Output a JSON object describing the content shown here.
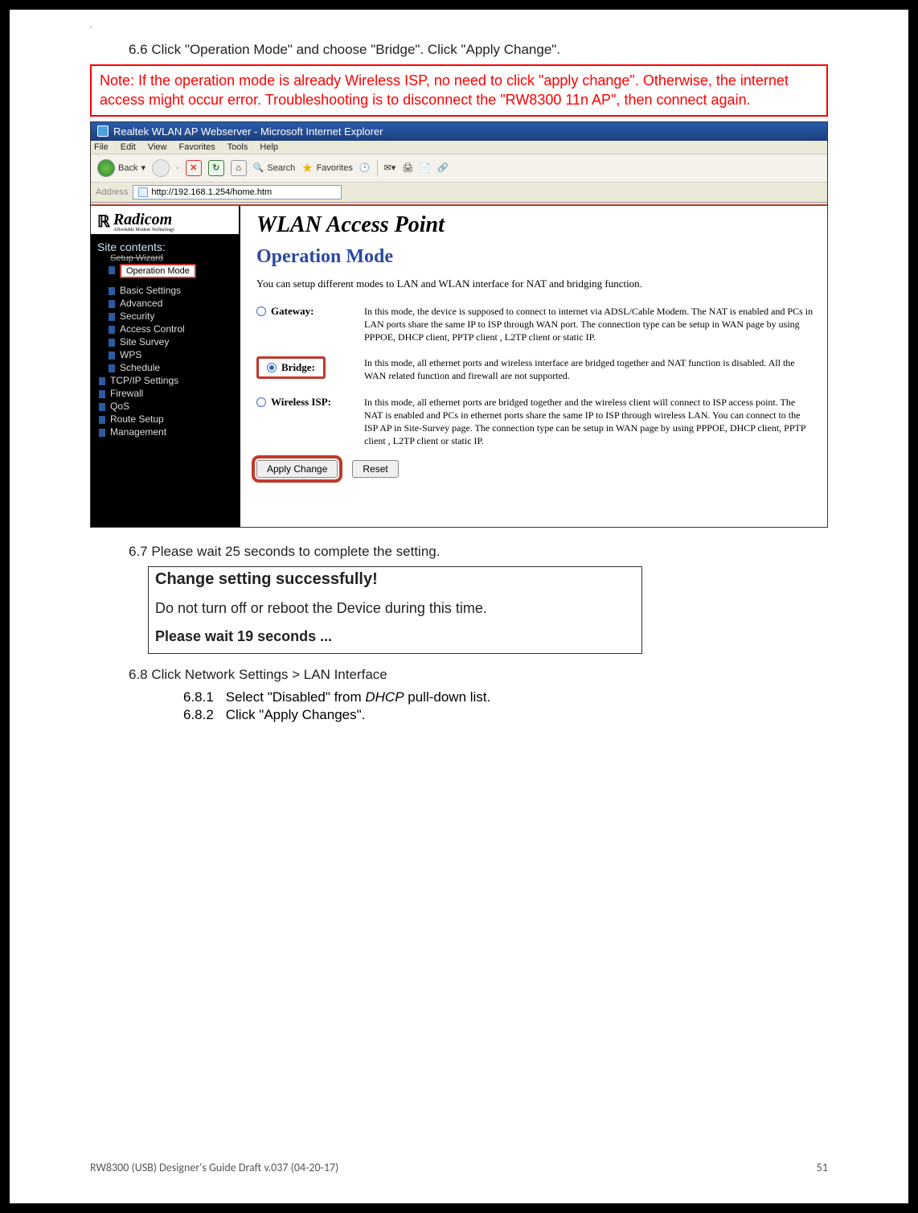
{
  "top_tick": "`",
  "step66": "6.6 Click \"Operation Mode\" and choose \"Bridge\". Click \"Apply Change\".",
  "note": "Note: If the operation mode is already Wireless ISP, no need to click \"apply change\". Otherwise, the internet access might occur error. Troubleshooting is to disconnect the \"RW8300 11n AP\", then connect again.",
  "ie": {
    "title": "Realtek WLAN AP Webserver - Microsoft Internet Explorer",
    "menus": [
      "File",
      "Edit",
      "View",
      "Favorites",
      "Tools",
      "Help"
    ],
    "back": "Back",
    "search": "Search",
    "favorites": "Favorites",
    "address_label": "Address",
    "url": "http://192.168.1.254/home.htm"
  },
  "logo": {
    "brand": "Radicom",
    "sub": "Affordable Modem Technology"
  },
  "sidebar": {
    "heading": "Site contents:",
    "struck": "Setup Wizard",
    "items": [
      {
        "label": "Operation Mode",
        "hl": true
      },
      {
        "label": "Basic Settings"
      },
      {
        "label": "Advanced"
      },
      {
        "label": "Security"
      },
      {
        "label": "Access Control"
      },
      {
        "label": "Site Survey"
      },
      {
        "label": "WPS"
      },
      {
        "label": "Schedule"
      },
      {
        "label": "TCP/IP Settings",
        "lvl": 1
      },
      {
        "label": "Firewall",
        "lvl": 1
      },
      {
        "label": "QoS",
        "lvl": 1
      },
      {
        "label": "Route Setup",
        "lvl": 1
      },
      {
        "label": "Management",
        "lvl": 1
      }
    ]
  },
  "main": {
    "wlan_title": "WLAN Access Point",
    "h2": "Operation Mode",
    "desc": "You can setup different modes to LAN and WLAN interface for NAT and bridging function.",
    "modes": [
      {
        "name": "Gateway:",
        "selected": false,
        "text": "In this mode, the device is supposed to connect to internet via ADSL/Cable Modem. The NAT is enabled and PCs in LAN ports share the same IP to ISP through WAN port. The connection type can be setup in WAN page by using PPPOE, DHCP client, PPTP client , L2TP client or static IP."
      },
      {
        "name": "Bridge:",
        "selected": true,
        "boxed": true,
        "text": "In this mode, all ethernet ports and wireless interface are bridged together and NAT function is disabled. All the WAN related function and firewall are not supported."
      },
      {
        "name": "Wireless ISP:",
        "selected": false,
        "text": "In this mode, all ethernet ports are bridged together and the wireless client will connect to ISP access point. The NAT is enabled and PCs in ethernet ports share the same IP to ISP through wireless LAN. You can connect to the ISP AP in Site-Survey page. The connection type can be setup in WAN page by using PPPOE, DHCP client, PPTP client , L2TP client or static IP."
      }
    ],
    "apply": "Apply Change",
    "reset": "Reset"
  },
  "step67": "6.7 Please wait 25 seconds to complete the setting.",
  "waitbox": {
    "l1": "Change setting successfully!",
    "l2": "Do not turn off or reboot the Device during this time.",
    "l3": "Please wait 19 seconds ..."
  },
  "step68": "6.8 Click Network Settings > LAN Interface",
  "step681_num": "6.8.1",
  "step681_a": "Select \"Disabled\" from ",
  "step681_i": "DHCP",
  "step681_b": " pull-down list.",
  "step682_num": "6.8.2",
  "step682": "Click \"Apply Changes\".",
  "footer_left": "RW8300 (USB) Designer's Guide Draft v.037 (04-20-17)",
  "footer_right": "51"
}
